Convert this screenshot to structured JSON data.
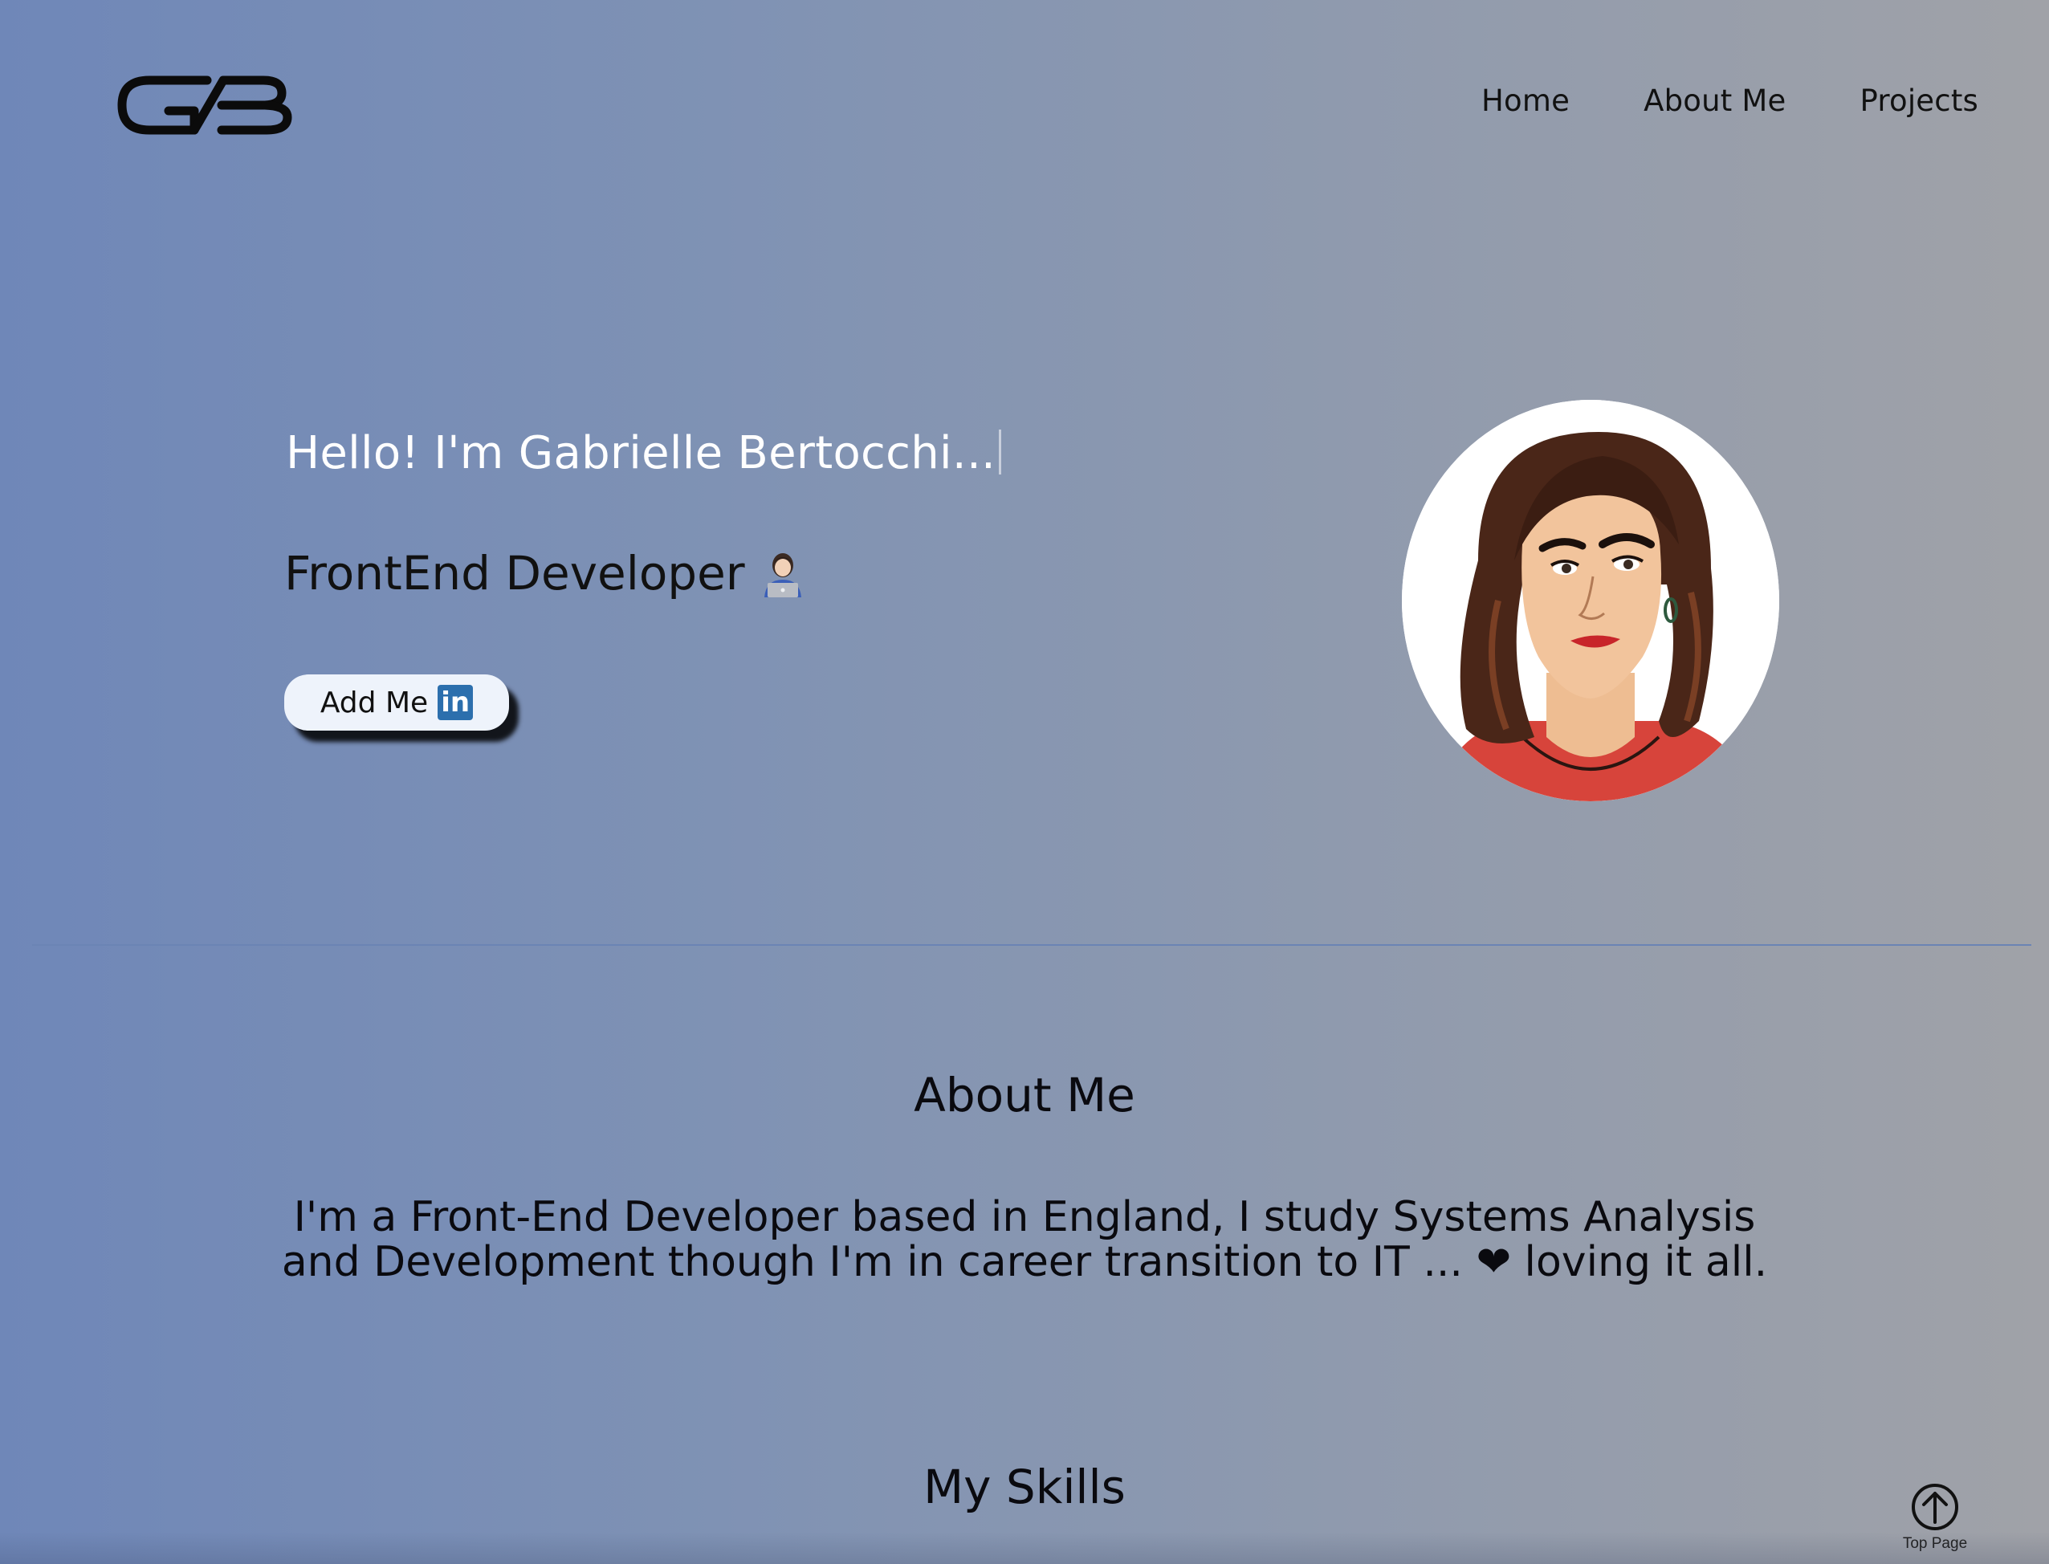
{
  "header": {
    "logo_alt": "GB",
    "nav": [
      {
        "label": "Home"
      },
      {
        "label": "About Me"
      },
      {
        "label": "Projects"
      }
    ]
  },
  "hero": {
    "greeting": "Hello! I'm Gabrielle Bertocchi...",
    "role": "FrontEnd Developer",
    "role_emoji": "technologist-icon",
    "cta_label": "Add Me",
    "cta_icon": "linkedin-icon",
    "cta_icon_text": "in",
    "avatar": "profile-portrait"
  },
  "about": {
    "title": "About Me",
    "text": "I'm a Front-End Developer based in England, I study Systems Analysis and Development though I'm in career transition to IT ... ❤ loving it all."
  },
  "skills": {
    "title": "My Skills"
  },
  "top_page": {
    "label": "Top Page",
    "icon": "arrow-up-circle-icon"
  },
  "colors": {
    "gradient_start": "#6f87b8",
    "gradient_end": "#a0a2a8",
    "linkedin_blue": "#2c6fad",
    "greeting_text": "#ffffff"
  }
}
